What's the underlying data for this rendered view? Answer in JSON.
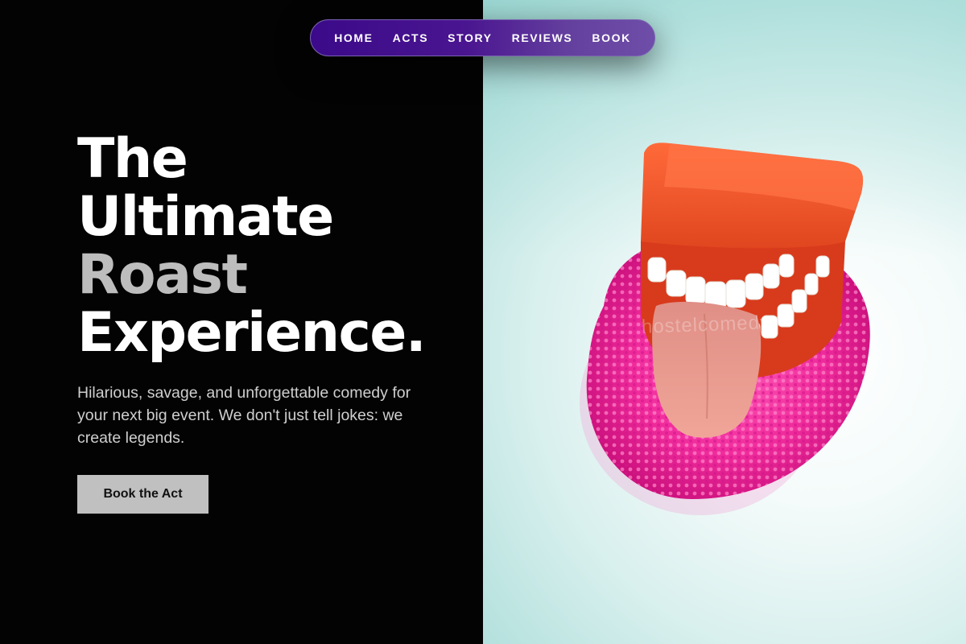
{
  "nav": {
    "items": [
      {
        "label": "HOME"
      },
      {
        "label": "ACTS"
      },
      {
        "label": "STORY"
      },
      {
        "label": "REVIEWS"
      },
      {
        "label": "BOOK"
      }
    ]
  },
  "hero": {
    "title_lines": [
      "The",
      "Ultimate",
      "Roast",
      "Experience."
    ],
    "subtitle": "Hilarious, savage, and unforgettable comedy for your next big event. We don't just tell jokes: we create legends.",
    "cta_label": "Book the Act",
    "image": {
      "subject": "wind-up chattering teeth toy with tongue out on pink scrubber",
      "watermark": "hostelcomedy"
    }
  },
  "colors": {
    "background": "#030303",
    "nav_gradient_start": "#3b0a8a",
    "nav_gradient_end": "#6e4ea8",
    "title_accent": "#bdbdbd",
    "cta_background": "#c0c0c0"
  }
}
